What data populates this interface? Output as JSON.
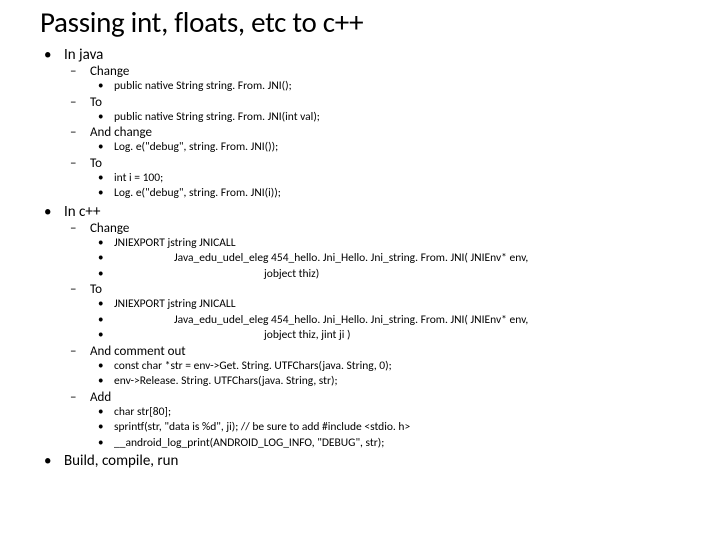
{
  "title": "Passing int, floats, etc to c++",
  "s1": {
    "head": "In java",
    "change": "Change",
    "change_code": "public native String  string. From. JNI();",
    "to1": "To",
    "to1_code": "public native String  string. From. JNI(int val);",
    "andchange": "And change",
    "andchange_code": "Log. e(\"debug\", string. From. JNI());",
    "to2": "To",
    "to2_code1": " int i = 100;",
    "to2_code2": "Log. e(\"debug\", string. From. JNI(i));"
  },
  "s2": {
    "head": "In c++",
    "change": "Change",
    "c1a": "JNIEXPORT jstring JNICALL",
    "c1b": "Java_edu_udel_eleg 454_hello. Jni_Hello. Jni_string. From. JNI( JNIEnv* env,",
    "c1c": "jobject thiz)",
    "to": "To",
    "c2a": "JNIEXPORT jstring JNICALL",
    "c2b": "Java_edu_udel_eleg 454_hello. Jni_Hello. Jni_string. From. JNI( JNIEnv* env,",
    "c2c": "jobject thiz, jint ji )",
    "comment": "And comment out",
    "c3a": "const char *str = env->Get. String. UTFChars(java. String, 0);",
    "c3b": "env->Release. String. UTFChars(java. String, str);",
    "add": "Add",
    "c4a": "char str[80];",
    "c4b": "sprintf(str, \"data is %d\", ji); // be sure to add #include <stdio. h>",
    "c4c": "__android_log_print(ANDROID_LOG_INFO, \"DEBUG\", str);"
  },
  "s3": {
    "head": "Build, compile, run"
  }
}
